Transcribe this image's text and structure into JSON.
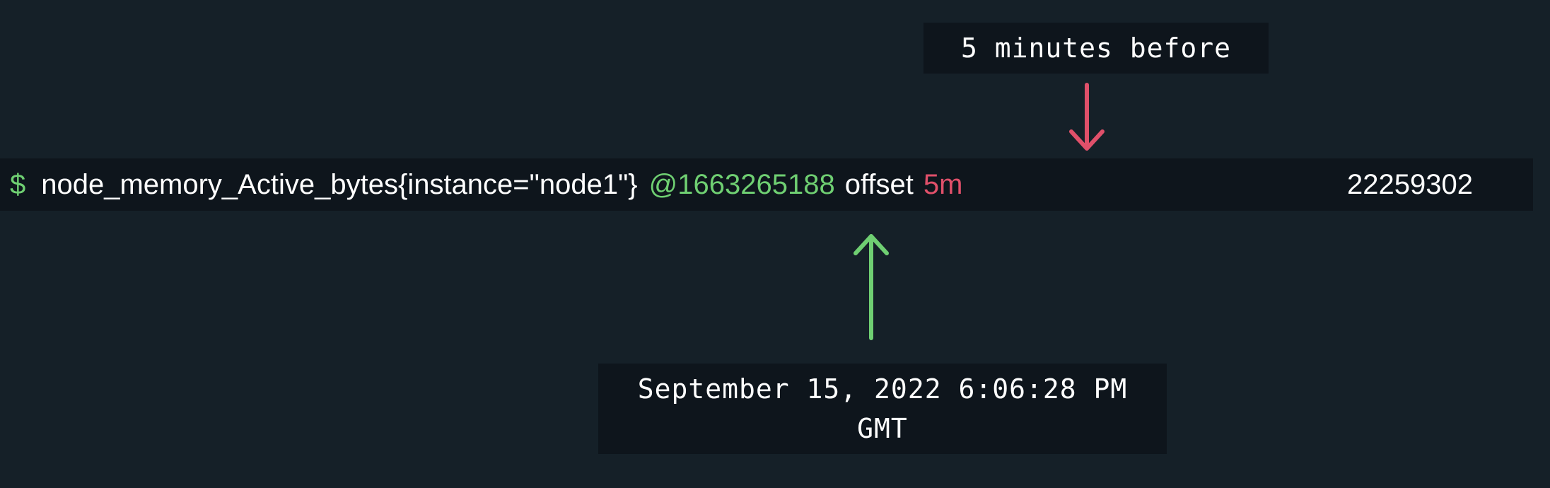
{
  "annotations": {
    "offset_label": "5 minutes before",
    "timestamp_label_line1": "September 15, 2022 6:06:28 PM",
    "timestamp_label_line2": "GMT"
  },
  "command": {
    "prompt": "$",
    "expression": "node_memory_Active_bytes{instance=\"node1\"}",
    "timestamp": "@1663265188",
    "keyword": "offset",
    "duration": "5m",
    "result": "22259302"
  },
  "colors": {
    "background": "#152028",
    "box": "#0e151c",
    "green": "#6fcf72",
    "red": "#e0506a"
  },
  "icons": {
    "offset_arrow": "arrow-down-icon",
    "timestamp_arrow": "arrow-up-icon"
  }
}
